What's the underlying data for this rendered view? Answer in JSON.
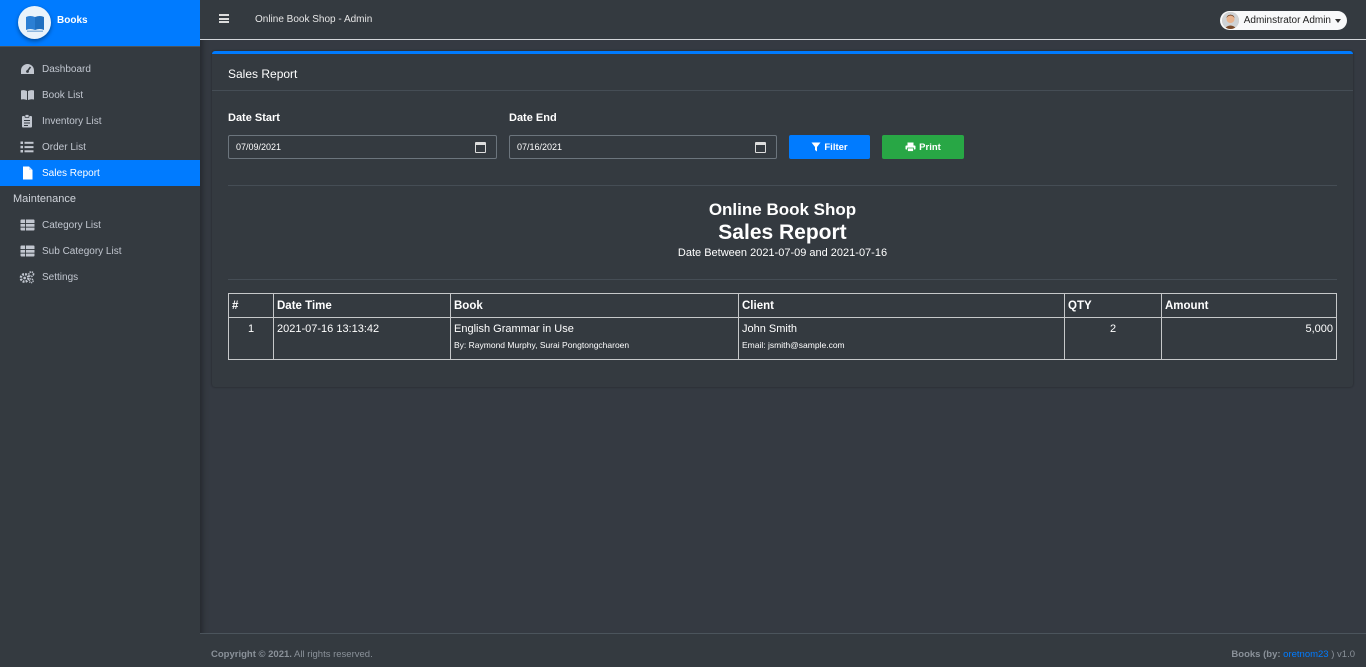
{
  "brand": {
    "name": "Books"
  },
  "sidebar": {
    "items": [
      {
        "label": "Dashboard",
        "icon": "dashboard-icon"
      },
      {
        "label": "Book List",
        "icon": "book-open-icon"
      },
      {
        "label": "Inventory List",
        "icon": "clipboard-icon"
      },
      {
        "label": "Order List",
        "icon": "list-icon"
      },
      {
        "label": "Sales Report",
        "icon": "file-icon",
        "active": true
      }
    ],
    "section_header": "Maintenance",
    "maintenance_items": [
      {
        "label": "Category List",
        "icon": "table-icon"
      },
      {
        "label": "Sub Category List",
        "icon": "table-icon"
      },
      {
        "label": "Settings",
        "icon": "cogs-icon"
      }
    ]
  },
  "topbar": {
    "title": "Online Book Shop - Admin",
    "user_name": "Adminstrator Admin"
  },
  "card": {
    "title": "Sales Report",
    "date_start_label": "Date Start",
    "date_start_value": "07/09/2021",
    "date_end_label": "Date End",
    "date_end_value": "07/16/2021",
    "filter_label": "Filter",
    "print_label": "Print"
  },
  "report": {
    "shop_name": "Online Book Shop",
    "title": "Sales Report",
    "date_range": "Date Between 2021-07-09 and 2021-07-16"
  },
  "table": {
    "headers": [
      "#",
      "Date Time",
      "Book",
      "Client",
      "QTY",
      "Amount"
    ],
    "rows": [
      {
        "index": "1",
        "datetime": "2021-07-16 13:13:42",
        "book_title": "English Grammar in Use",
        "book_authors": "By: Raymond Murphy, Surai Pongtongcharoen",
        "client_name": "John Smith",
        "client_email": "Email: jsmith@sample.com",
        "qty": "2",
        "amount": "5,000"
      }
    ]
  },
  "footer": {
    "copyright": "Copyright © 2021.",
    "rights": "All rights reserved.",
    "app_name": "Books",
    "by_label": "(by:",
    "author": "oretnom23",
    "version": ") v1.0"
  },
  "colors": {
    "accent": "#007bff",
    "success": "#28a745",
    "background": "#353a42",
    "sidebar": "#343a40"
  }
}
